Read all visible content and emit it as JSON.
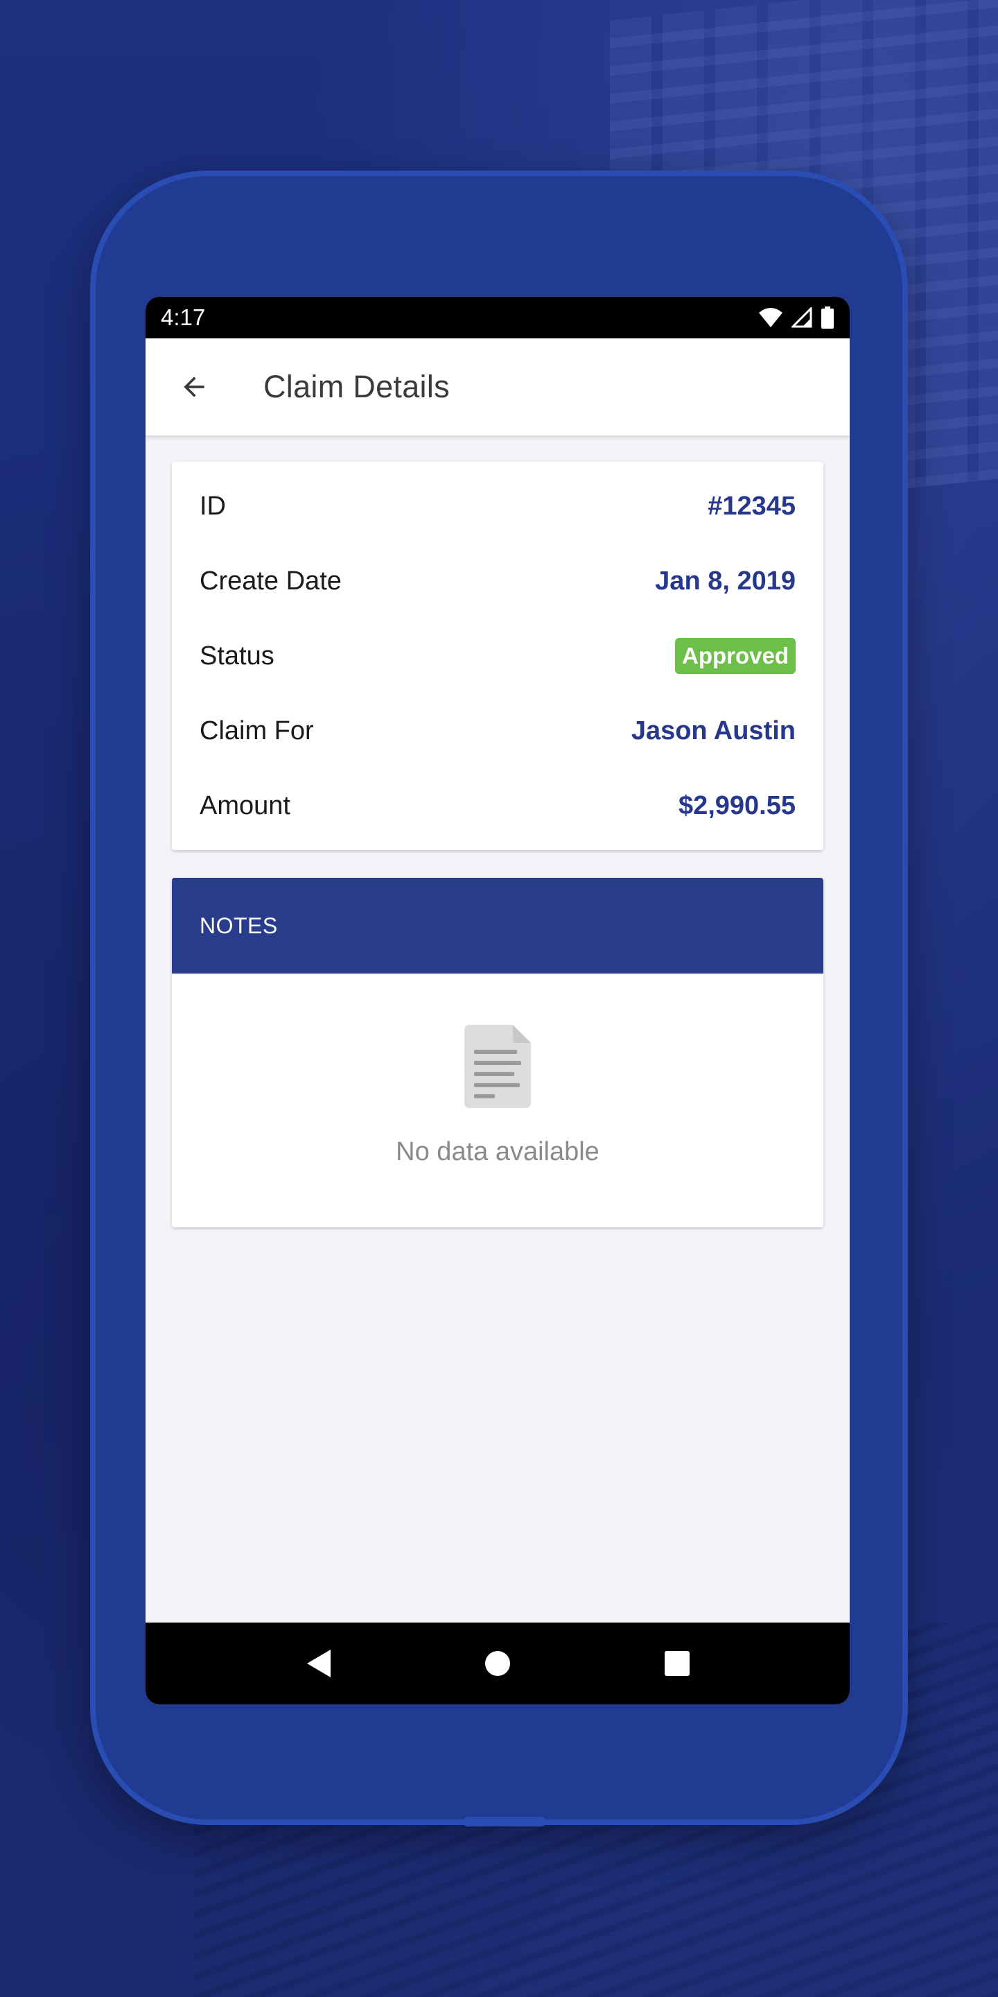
{
  "status_bar": {
    "time": "4:17"
  },
  "app_bar": {
    "title": "Claim Details"
  },
  "details": [
    {
      "label": "ID",
      "value": "#12345"
    },
    {
      "label": "Create Date",
      "value": "Jan 8, 2019"
    },
    {
      "label": "Status",
      "value": "Approved"
    },
    {
      "label": "Claim For",
      "value": "Jason Austin"
    },
    {
      "label": "Amount",
      "value": "$2,990.55"
    }
  ],
  "notes": {
    "header": "NOTES",
    "empty_text": "No data available"
  },
  "icons": {
    "back": "arrow-back-icon",
    "empty": "document-icon",
    "wifi": "wifi-icon",
    "signal": "signal-icon",
    "battery": "battery-icon",
    "nav_back": "triangle-back-icon",
    "nav_home": "circle-home-icon",
    "nav_recents": "square-recents-icon"
  },
  "colors": {
    "accent": "#26378c",
    "notes_header": "#283c8c",
    "status_approved": "#6cc04a",
    "background": "#1c2d7a",
    "phone_frame": "#213a92"
  }
}
